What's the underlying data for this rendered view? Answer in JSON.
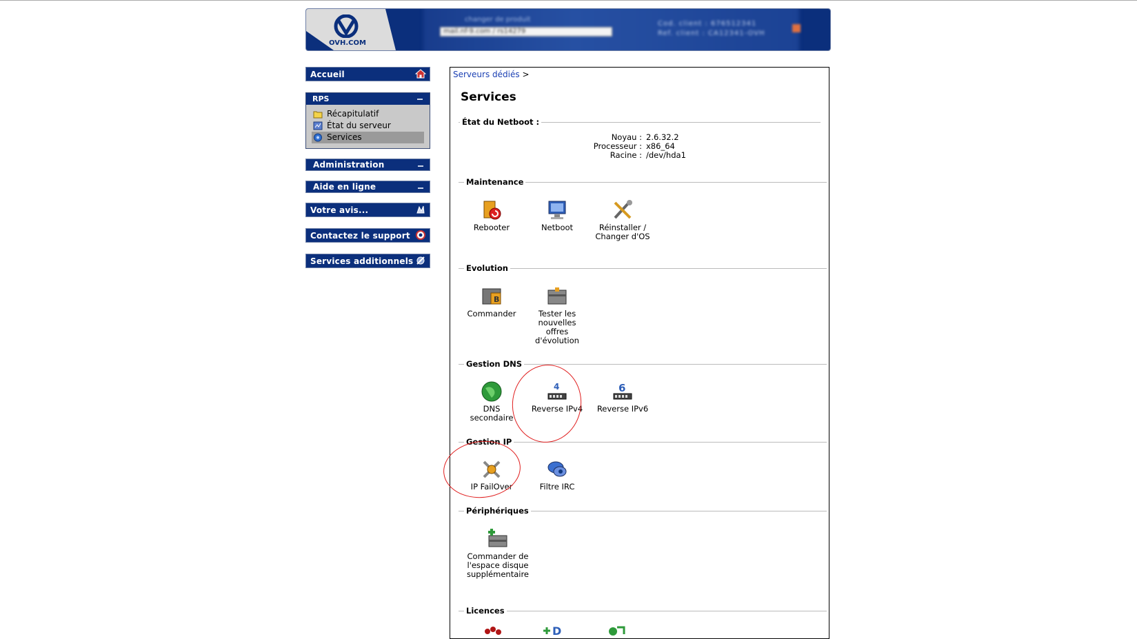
{
  "header": {
    "logo_text": "OVH.COM",
    "product_label": "changer de produit",
    "product_select_value": "mail.nf-9.com / rs14279",
    "client_info_1": "Cod. client : 676512341",
    "client_info_2": "Ref. client : CA12341-OVH"
  },
  "sidebar": {
    "accueil": "Accueil",
    "rps": {
      "title": "RPS",
      "items": [
        {
          "label": "Récapitulatif",
          "icon": "folder-icon"
        },
        {
          "label": "État du serveur",
          "icon": "server-status-icon"
        },
        {
          "label": "Services",
          "icon": "services-icon",
          "selected": true
        }
      ]
    },
    "administration": "Administration",
    "aide": "Aide en ligne",
    "avis": "Votre avis...",
    "support": "Contactez le support",
    "additionnels": "Services additionnels"
  },
  "main": {
    "breadcrumb": {
      "link": "Serveurs dédiés",
      "sep": ">"
    },
    "title": "Services",
    "netboot": {
      "heading": "État du Netboot :",
      "rows": [
        {
          "key": "Noyau :",
          "value": "2.6.32.2"
        },
        {
          "key": "Processeur :",
          "value": "x86_64"
        },
        {
          "key": "Racine :",
          "value": "/dev/hda1"
        }
      ]
    },
    "maintenance": {
      "heading": "Maintenance",
      "tiles": [
        {
          "label": "Rebooter"
        },
        {
          "label": "Netboot"
        },
        {
          "label": "Réinstaller / Changer d'OS"
        }
      ]
    },
    "evolution": {
      "heading": "Evolution",
      "tiles": [
        {
          "label": "Commander"
        },
        {
          "label": "Tester les nouvelles offres d'évolution"
        }
      ]
    },
    "dns": {
      "heading": "Gestion DNS",
      "tiles": [
        {
          "label": "DNS secondaire"
        },
        {
          "label": "Reverse IPv4"
        },
        {
          "label": "Reverse IPv6"
        }
      ]
    },
    "ip": {
      "heading": "Gestion IP",
      "tiles": [
        {
          "label": "IP FailOver"
        },
        {
          "label": "Filtre IRC"
        }
      ]
    },
    "peripheriques": {
      "heading": "Périphériques",
      "tiles": [
        {
          "label": "Commander de l'espace disque supplémentaire"
        }
      ]
    },
    "licences": {
      "heading": "Licences"
    }
  },
  "annotations": {
    "color": "#e01d1d"
  }
}
